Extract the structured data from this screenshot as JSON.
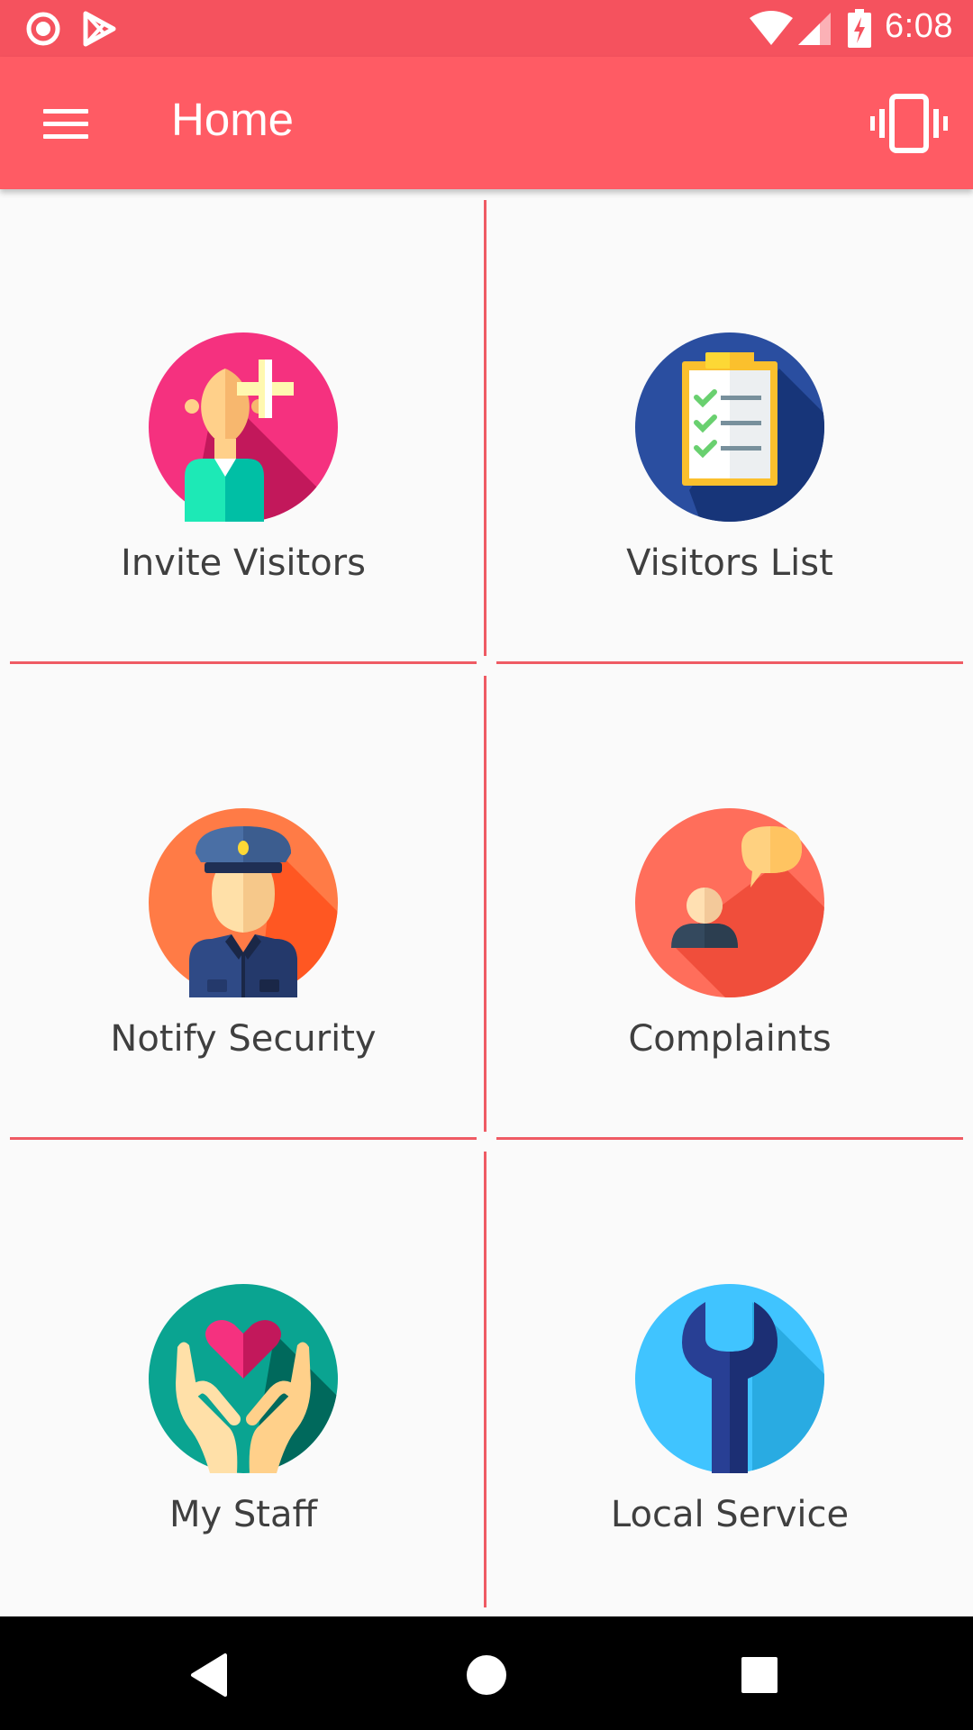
{
  "status_bar": {
    "time": "6:08",
    "icons": [
      "record-icon",
      "play-store-icon",
      "wifi-icon",
      "signal-icon",
      "battery-charging-icon"
    ]
  },
  "app_bar": {
    "title": "Home",
    "left_icon": "hamburger-menu-icon",
    "right_icon": "vibrate-icon"
  },
  "tiles": [
    {
      "label": "Invite Visitors",
      "icon": "add-person-icon",
      "color": "#f5317f"
    },
    {
      "label": "Visitors List",
      "icon": "clipboard-checklist-icon",
      "color": "#2a4ea0"
    },
    {
      "label": "Notify Security",
      "icon": "security-guard-icon",
      "color": "#ff7b46"
    },
    {
      "label": "Complaints",
      "icon": "person-speech-bubble-icon",
      "color": "#ff6e5b"
    },
    {
      "label": "My Staff",
      "icon": "hands-heart-icon",
      "color": "#0aa491"
    },
    {
      "label": "Local Service",
      "icon": "wrench-icon",
      "color": "#40c4ff"
    }
  ],
  "nav_bar": {
    "buttons": [
      "back-icon",
      "home-icon",
      "recents-icon"
    ]
  },
  "colors": {
    "status_bar": "#f5525e",
    "app_bar": "#ff5b64",
    "divider": "#ef5b64",
    "background": "#fafafa"
  }
}
